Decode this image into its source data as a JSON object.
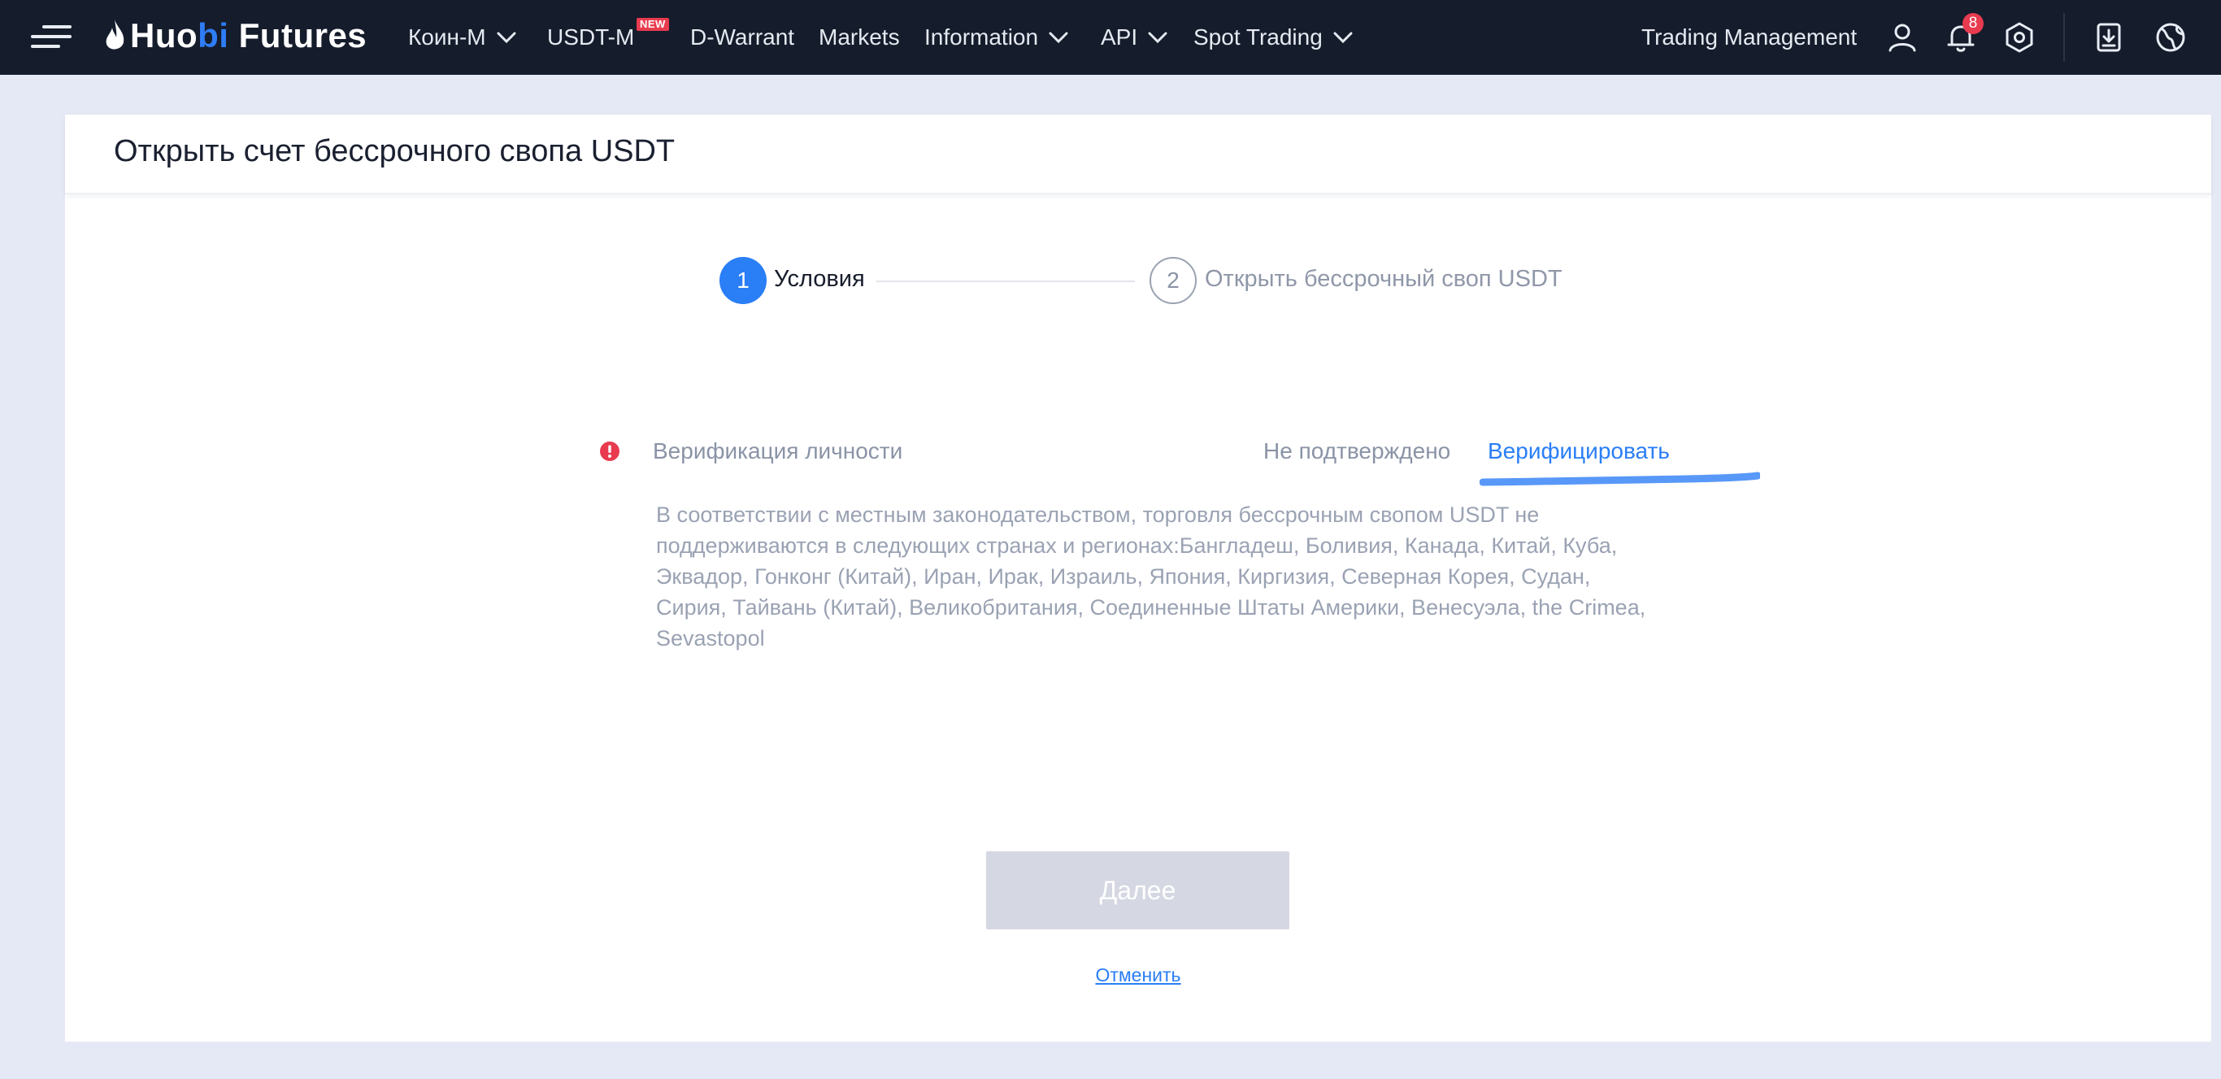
{
  "navbar": {
    "logo": {
      "part1": "Huo",
      "part2": "bi",
      "part3": " Futures"
    },
    "items": [
      {
        "label": "Коин-М"
      },
      {
        "label": "USDT-M",
        "badge": "NEW"
      },
      {
        "label": "D-Warrant"
      },
      {
        "label": "Markets"
      },
      {
        "label": "Information"
      },
      {
        "label": "API"
      },
      {
        "label": "Spot Trading"
      }
    ],
    "trading_management": "Trading Management",
    "notification_count": "8",
    "icons": [
      "menu-icon",
      "user-icon",
      "bell-icon",
      "settings-hex-icon",
      "download-icon",
      "globe-icon"
    ]
  },
  "page": {
    "title": "Открыть счет бессрочного свопа USDT"
  },
  "steps": [
    {
      "number": "1",
      "label": "Условия",
      "active": true
    },
    {
      "number": "2",
      "label": "Открыть бессрочный своп USDT",
      "active": false
    }
  ],
  "verification": {
    "label": "Верификация личности",
    "status": "Не подтверждено",
    "action": "Верифицировать"
  },
  "notice": "В соответствии с местным законодательством, торговля бессрочным свопом USDT не поддерживаются в следующих странах и регионах:Бангладеш, Боливия, Канада, Китай, Куба, Эквадор, Гонконг (Китай), Иран, Ирак, Израиль, Япония, Киргизия, Северная Корея, Судан, Сирия, Тайвань (Китай), Великобритания, Соединенные Штаты Америки, Венесуэла, the Crimea, Sevastopol",
  "buttons": {
    "next": "Далее",
    "cancel": "Отменить"
  },
  "colors": {
    "navbar_bg": "#151c2b",
    "accent": "#2a7ef6",
    "alert": "#e83b4f",
    "page_bg": "#e5e9f5",
    "disabled_button": "#d5d8e2"
  }
}
